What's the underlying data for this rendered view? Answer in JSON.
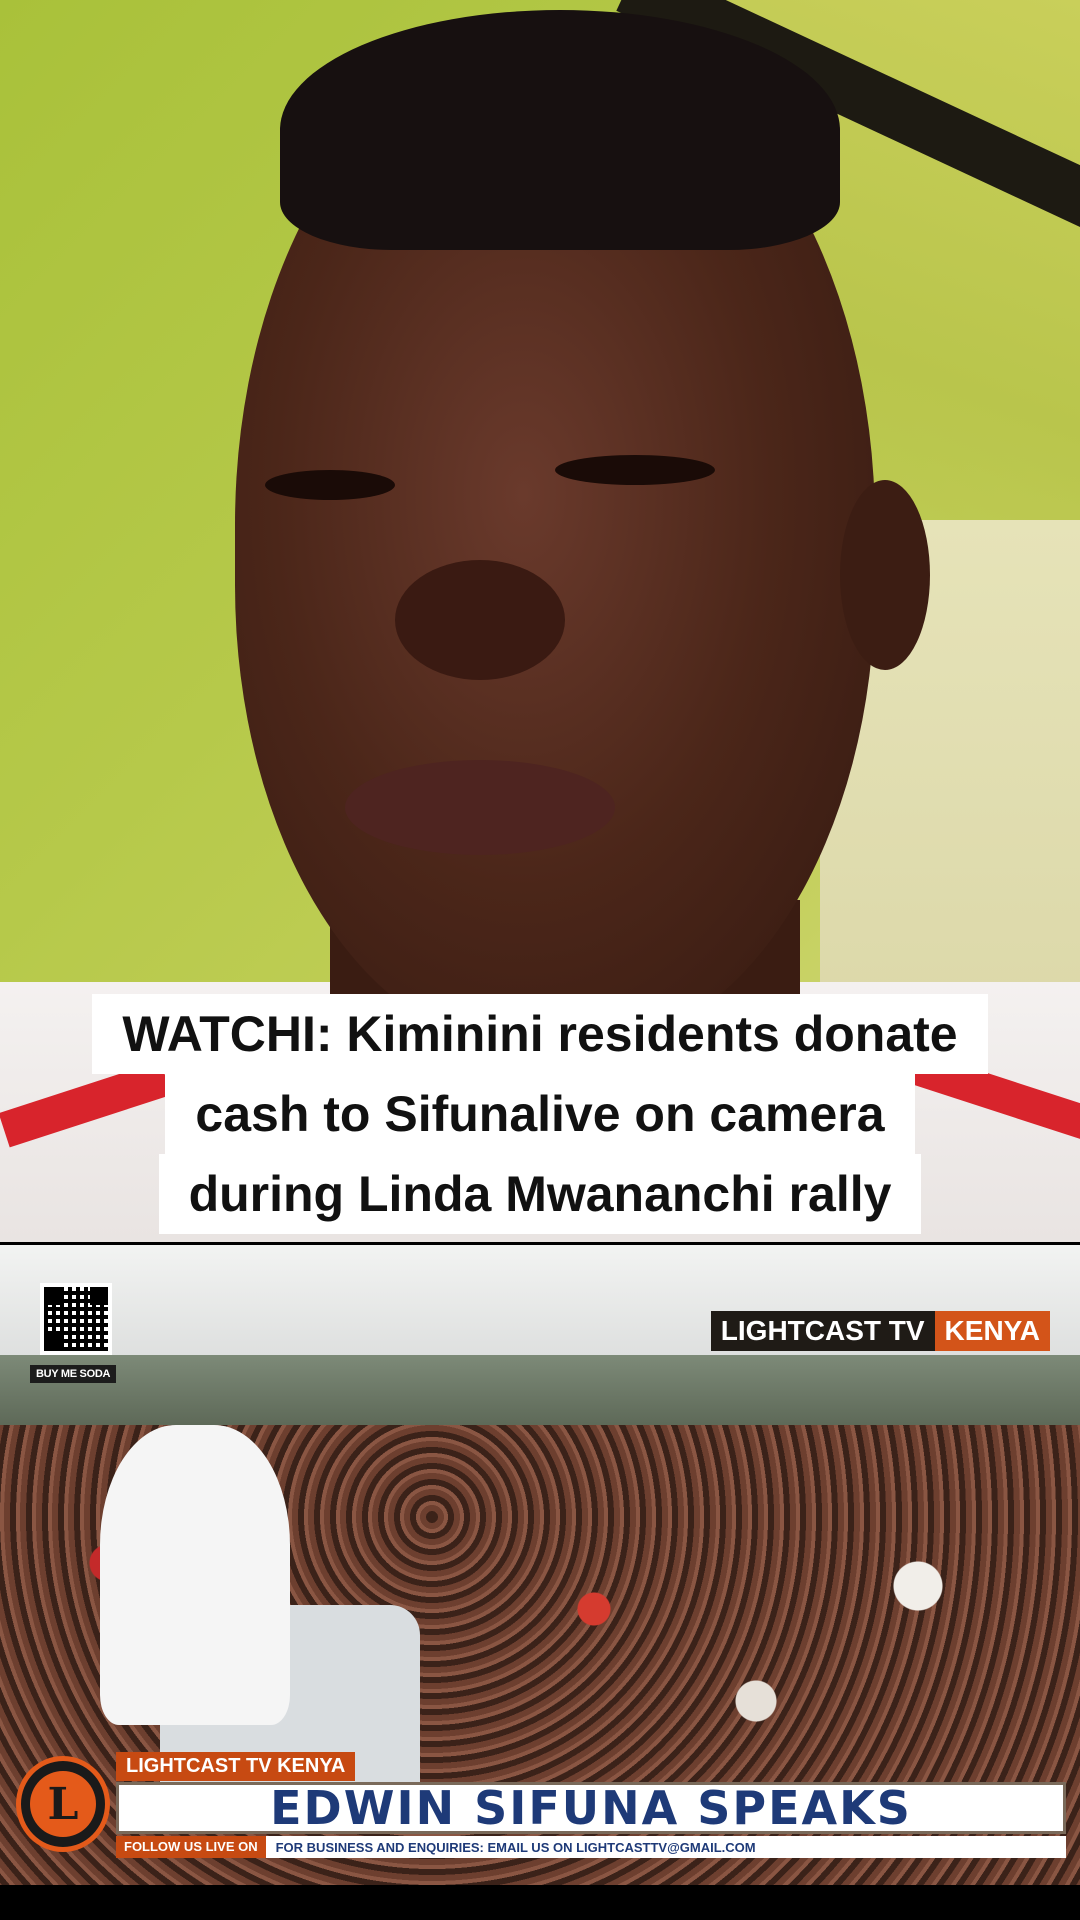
{
  "caption": {
    "lines": [
      "WATCHI: Kiminini residents donate",
      "cash to Sifunalive on camera",
      "during Linda Mwananchi rally"
    ]
  },
  "news": {
    "buy_soda": "BUY ME SODA",
    "logo_top_right": {
      "part1": "LIGHTCAST TV",
      "part2": "KENYA"
    },
    "lower_third": {
      "logo_letter": "L",
      "tag": "LIGHTCAST TV KENYA",
      "headline": "EDWIN SIFUNA SPEAKS",
      "follow": "FOLLOW US LIVE ON",
      "email": "FOR BUSINESS AND ENQUIRIES: EMAIL US ON LIGHTCASTTV@GMAIL.COM"
    }
  },
  "colors": {
    "accent_orange": "#c74a12",
    "headline_blue": "#1e3a78",
    "wall_green": "#b6c94a"
  }
}
